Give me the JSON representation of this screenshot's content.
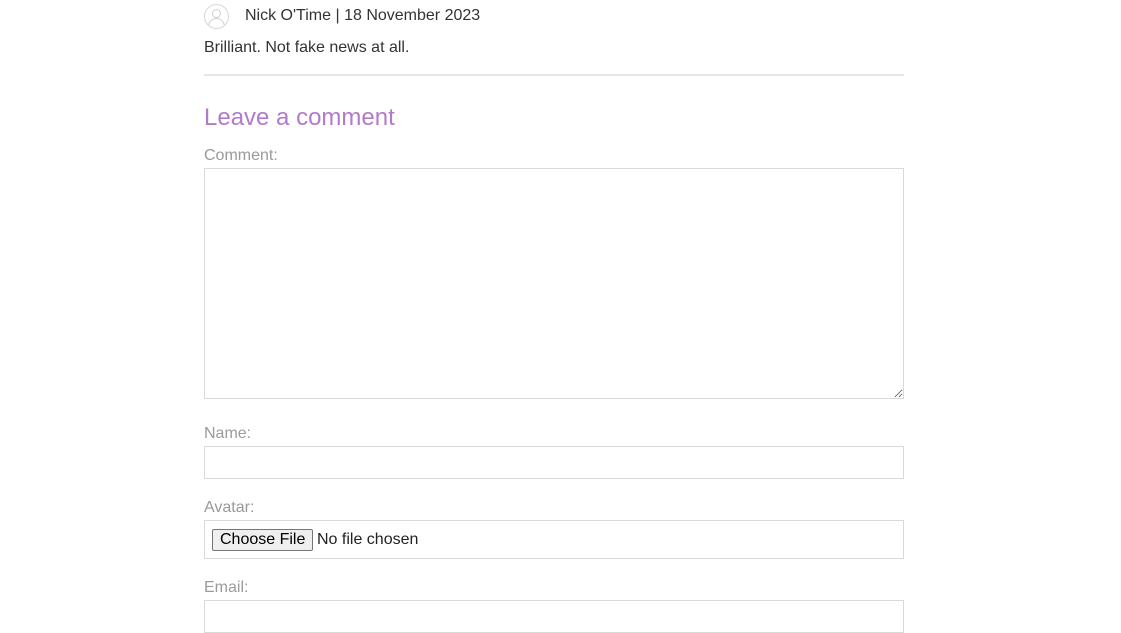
{
  "comment": {
    "avatar_icon": "default-user-icon",
    "author": "Nick O'Time",
    "separator": "|",
    "date": "18 November 2023",
    "body": "Brilliant. Not fake news at all."
  },
  "form": {
    "heading": "Leave a comment",
    "comment_label": "Comment:",
    "comment_value": "",
    "name_label": "Name:",
    "name_value": "",
    "avatar_label": "Avatar:",
    "file_button_label": "Choose File",
    "file_status": "No file chosen",
    "email_label": "Email:",
    "email_value": ""
  },
  "colors": {
    "heading": "#b27bc9",
    "label": "#9a9a9a",
    "text": "#333333",
    "border": "#d9d9d9"
  }
}
